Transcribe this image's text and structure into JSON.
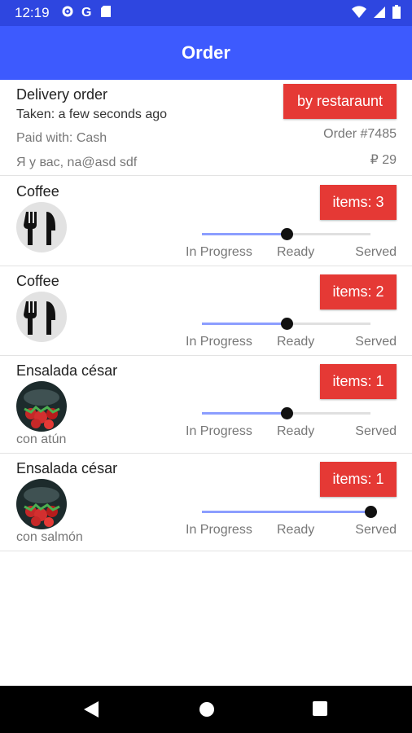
{
  "status_bar": {
    "time": "12:19",
    "icons_left": [
      "gear-icon",
      "google-icon",
      "sd-card-icon"
    ],
    "icons_right": [
      "wifi-icon",
      "signal-icon",
      "battery-icon"
    ]
  },
  "app_bar": {
    "title": "Order"
  },
  "order": {
    "title": "Delivery order",
    "taken": "Taken: a few seconds ago",
    "paid": "Paid with: Cash",
    "user": "Я у вас, na@asd sdf",
    "restaurant_button": "by restaraunt",
    "number": "Order #7485",
    "price": "₽ 29"
  },
  "stages": [
    "In Progress",
    "Ready",
    "Served"
  ],
  "items": [
    {
      "name": "Coffee",
      "count_label": "items: 3",
      "note": "",
      "image": "cutlery-icon",
      "progress": 0.5
    },
    {
      "name": "Coffee",
      "count_label": "items: 2",
      "note": "",
      "image": "cutlery-icon",
      "progress": 0.5
    },
    {
      "name": "Ensalada césar",
      "count_label": "items: 1",
      "note": "con atún",
      "image": "salad-photo",
      "progress": 0.5
    },
    {
      "name": "Ensalada césar",
      "count_label": "items: 1",
      "note": "con salmón",
      "image": "salad-photo",
      "progress": 1.0
    }
  ],
  "colors": {
    "status_bar": "#2e46e0",
    "app_bar": "#3d5afe",
    "badge": "#e53935",
    "track_fill": "#8c9eff"
  }
}
